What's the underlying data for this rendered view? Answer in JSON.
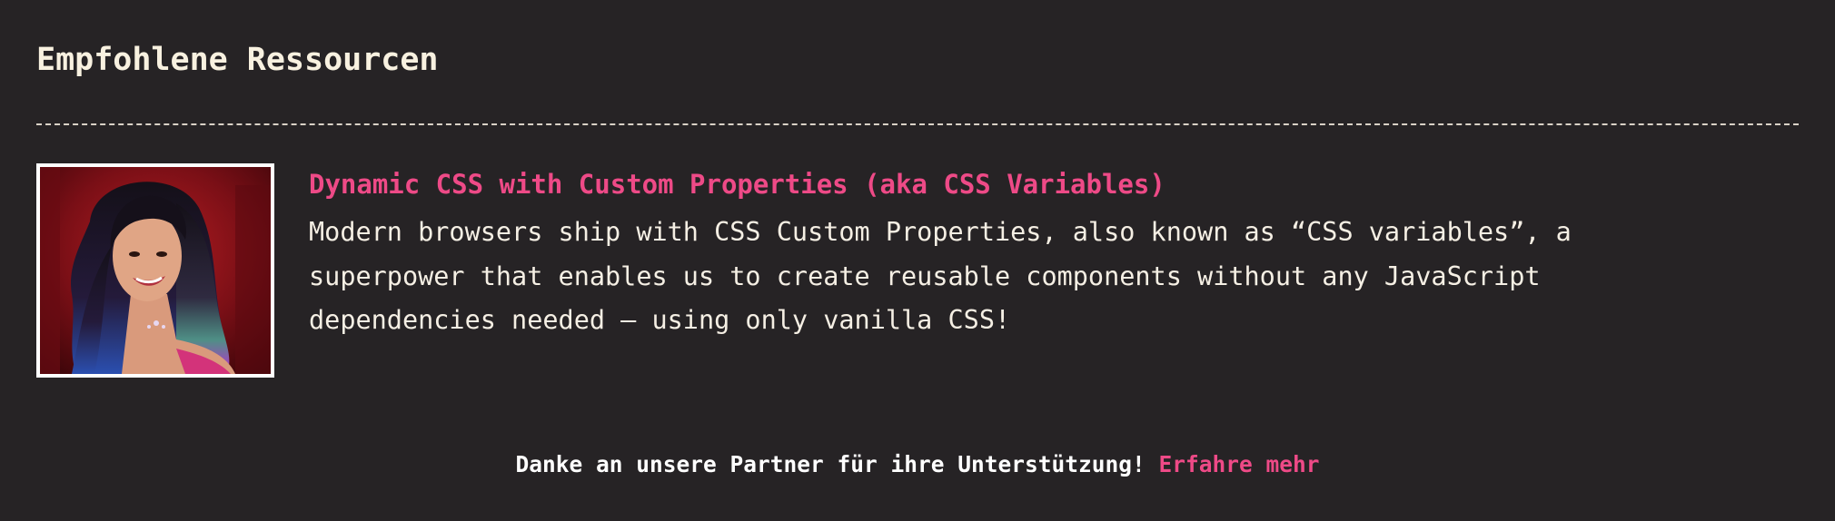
{
  "section": {
    "title": "Empfohlene Ressourcen"
  },
  "resource": {
    "title": "Dynamic CSS with Custom Properties (aka CSS Variables)",
    "description": "Modern browsers ship with CSS Custom Properties, also known as “CSS variables”, a superpower that enables us to create reusable components without any JavaScript dependencies needed — using only vanilla CSS!",
    "image_subject": "portrait-photo"
  },
  "footer": {
    "thanks_text": "Danke an unsere Partner für ihre Unterstützung!",
    "link_text": "Erfahre mehr"
  },
  "colors": {
    "background": "#262325",
    "text": "#f5efe4",
    "accent": "#ee4a87"
  }
}
